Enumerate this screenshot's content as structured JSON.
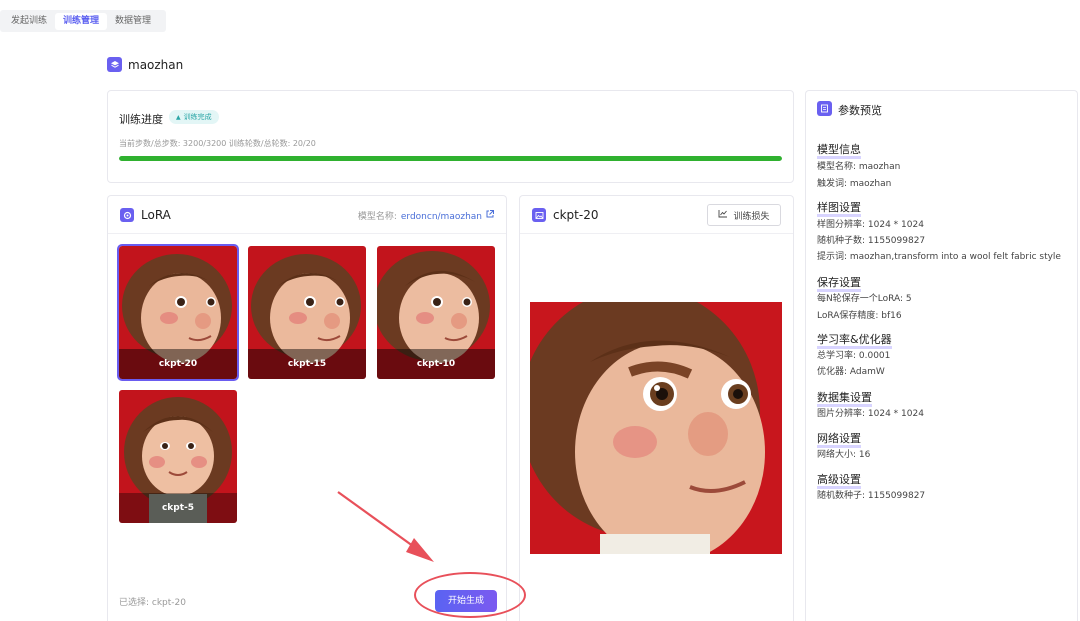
{
  "tabs": [
    {
      "label": "发起训练",
      "active": false
    },
    {
      "label": "训练管理",
      "active": true
    },
    {
      "label": "数据管理",
      "active": false
    }
  ],
  "project": {
    "name": "maozhan"
  },
  "progress": {
    "title": "训练进度",
    "badge": "训练完成",
    "steps_text": "当前步数/总步数: 3200/3200  训练轮数/总轮数: 20/20",
    "percent": 100
  },
  "lora": {
    "title": "LoRA",
    "model_label": "模型名称:",
    "model_link": "erdoncn/maozhan",
    "checkpoints": [
      {
        "label": "ckpt-20",
        "selected": true
      },
      {
        "label": "ckpt-15",
        "selected": false
      },
      {
        "label": "ckpt-10",
        "selected": false
      },
      {
        "label": "ckpt-5",
        "selected": false
      }
    ],
    "selected_text": "已选择: ckpt-20",
    "generate_button": "开始生成"
  },
  "preview": {
    "title": "ckpt-20",
    "loss_button": "训练损失"
  },
  "params": {
    "title": "参数预览",
    "sections": [
      {
        "title": "模型信息",
        "items": [
          "模型名称: maozhan",
          "触发词: maozhan"
        ]
      },
      {
        "title": "样图设置",
        "items": [
          "样图分辨率: 1024 * 1024",
          "随机种子数: 1155099827",
          "提示词: maozhan,transform into a wool felt fabric style"
        ]
      },
      {
        "title": "保存设置",
        "items": [
          "每N轮保存一个LoRA: 5",
          "LoRA保存精度: bf16"
        ]
      },
      {
        "title": "学习率&优化器",
        "items": [
          "总学习率: 0.0001",
          "优化器: AdamW"
        ]
      },
      {
        "title": "数据集设置",
        "items": [
          "图片分辨率: 1024 * 1024"
        ]
      },
      {
        "title": "网络设置",
        "items": [
          "网络大小: 16"
        ]
      },
      {
        "title": "高级设置",
        "items": [
          "随机数种子: 1155099827"
        ]
      }
    ]
  },
  "colors": {
    "accent": "#6a60f0",
    "progress": "#2fb12f",
    "annotation": "#e8505a"
  }
}
